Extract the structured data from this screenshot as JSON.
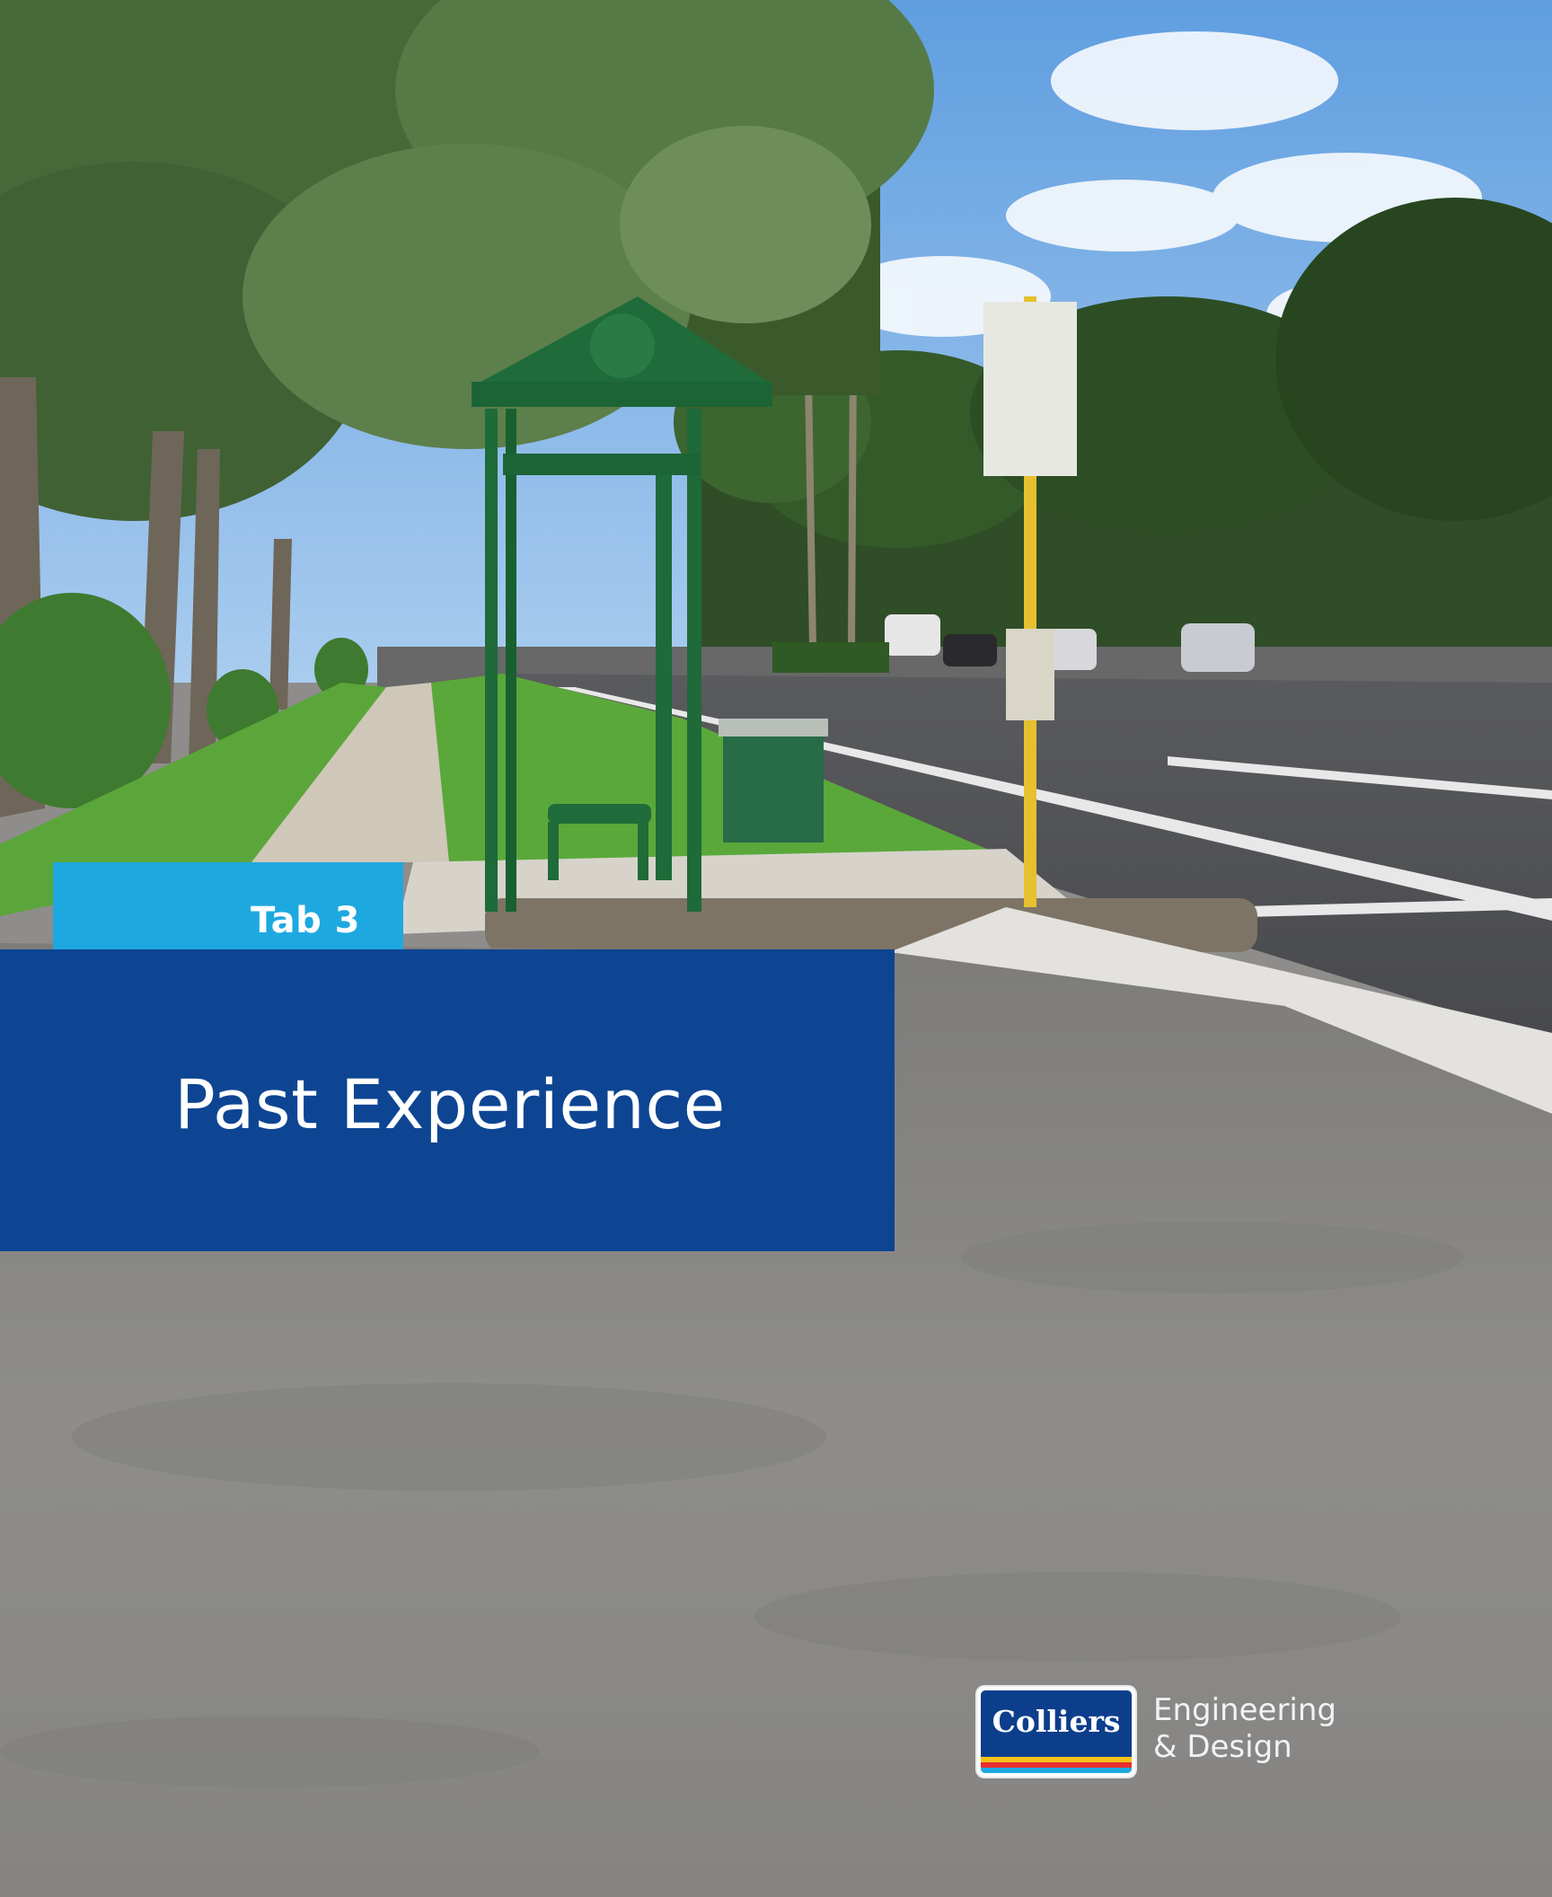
{
  "cover": {
    "tab_label": "Tab 3",
    "title": "Past Experience"
  },
  "logo": {
    "wordmark": "Colliers",
    "line1": "Engineering",
    "line2": "& Design",
    "stripe_colors": [
      "#f4c31c",
      "#e8302f",
      "#1ea8e0"
    ]
  },
  "colors": {
    "tab_accent": "#1ea8e0",
    "title_band": "#0d4593"
  }
}
